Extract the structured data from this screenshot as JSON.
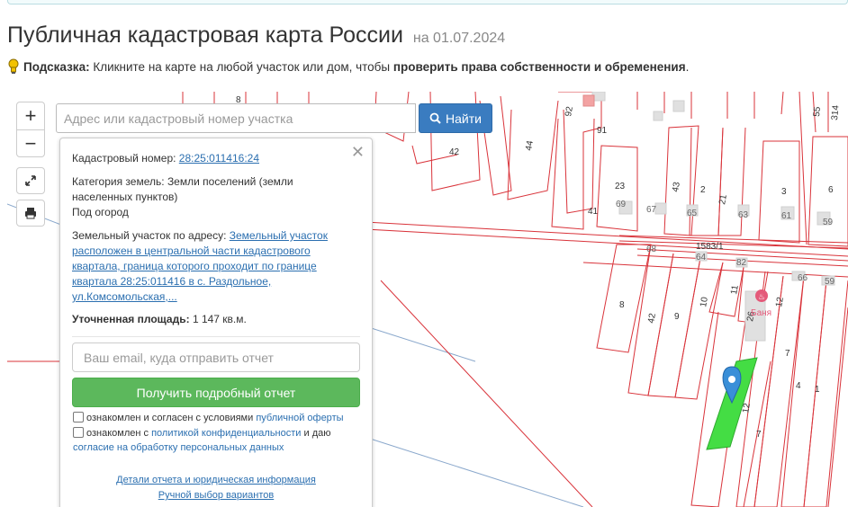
{
  "header": {
    "title": "Публичная кадастровая карта России",
    "date": "на 01.07.2024"
  },
  "hint": {
    "label": "Подсказка:",
    "text": "Кликните на карте на любой участок или дом, чтобы",
    "bold": "проверить права собственности и обременения",
    "end": "."
  },
  "search": {
    "placeholder": "Адрес или кадастровый номер участка",
    "button": "Найти"
  },
  "zoom": {
    "in": "+",
    "out": "−"
  },
  "popup": {
    "cadastral_label": "Кадастровый номер:",
    "cadastral_number": "28:25:011416:24",
    "category_label": "Категория земель:",
    "category_value_1": "Земли поселений (земли",
    "category_value_2": "населенных пунктов)",
    "usage": "Под огород",
    "address_label": "Земельный участок по адресу:",
    "address_link_1": "Земельный участок",
    "address_link_2": "расположен в центральной части кадастрового",
    "address_link_3": "квартала, граница которого проходит по границе",
    "address_link_4": "квартала 28:25:011416 в с. Раздольное,",
    "address_link_5": "ул.Комсомольская,...",
    "area_label": "Уточненная площадь:",
    "area_value": "1 147 кв.м.",
    "email_placeholder": "Ваш email, куда отправить отчет",
    "report_button": "Получить подробный отчет",
    "consent_1_text": "ознакомлен и согласен с условиями",
    "consent_1_link": "публичной оферты",
    "consent_2_text": "ознакомлен с",
    "consent_2_link": "политикой конфиденциальности",
    "consent_2_mid": "и даю",
    "consent_2_link2": "согласие на обработку персональных данных",
    "details_link": "Детали отчета и юридическая информация",
    "manual_link": "Ручной выбор вариантов"
  },
  "map": {
    "parcel_labels": [
      "8",
      "92",
      "91",
      "44",
      "42",
      "23",
      "41",
      "69",
      "67",
      "43",
      "65",
      "2",
      "21",
      "63",
      "3",
      "61",
      "55",
      "314",
      "6",
      "59",
      "1583/1",
      "68",
      "64",
      "82",
      "66",
      "59",
      "8",
      "42",
      "9",
      "10",
      "11",
      "26",
      "12",
      "7",
      "4",
      "1",
      "12",
      "7"
    ],
    "poi_label": "Баня",
    "colors": {
      "parcel": "#d9333a",
      "selected": "#44dd44",
      "marker": "#3a8fd8",
      "building": "#dddddd"
    }
  }
}
